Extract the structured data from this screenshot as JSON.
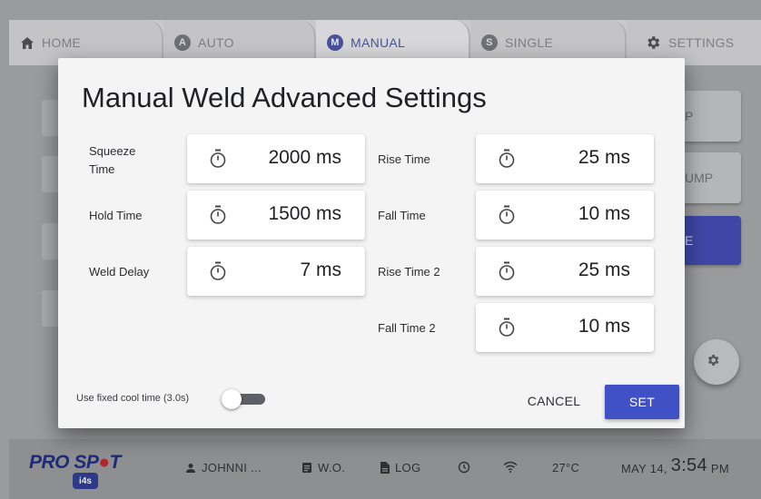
{
  "tabs": [
    {
      "label": "HOME",
      "icon": "home-icon"
    },
    {
      "label": "AUTO",
      "badge": "A"
    },
    {
      "label": "MANUAL",
      "badge": "M",
      "active": true
    },
    {
      "label": "SINGLE",
      "badge": "S"
    },
    {
      "label": "SETTINGS",
      "icon": "gear-icon"
    }
  ],
  "background": {
    "side_buttons": [
      "P",
      "UMP",
      "E"
    ]
  },
  "dialog": {
    "title": "Manual Weld Advanced Settings",
    "fields_left": [
      {
        "label": "Squeeze\nTime",
        "value": "2000 ms",
        "icon": "timer-icon"
      },
      {
        "label": "Hold Time",
        "value": "1500 ms",
        "icon": "timer-icon"
      },
      {
        "label": "Weld Delay",
        "value": "7 ms",
        "icon": "timer-icon"
      }
    ],
    "fields_right": [
      {
        "label": "Rise Time",
        "value": "25 ms",
        "icon": "timer-icon"
      },
      {
        "label": "Fall Time",
        "value": "10 ms",
        "icon": "timer-icon"
      },
      {
        "label": "Rise Time 2",
        "value": "25 ms",
        "icon": "timer-icon"
      },
      {
        "label": "Fall Time 2",
        "value": "10 ms",
        "icon": "timer-icon"
      }
    ],
    "toggle_label": "Use fixed cool time (3.0s)",
    "toggle_on": false,
    "cancel_label": "CANCEL",
    "set_label": "SET",
    "accent_color": "#3f51c4"
  },
  "statusbar": {
    "logo_main": "PRO SP",
    "logo_red": "●",
    "logo_end": "T",
    "logo_sub": "i4s",
    "user": "JOHNNI ...",
    "wo": "W.O.",
    "log": "LOG",
    "temperature": "27°C",
    "date": "MAY 14,",
    "time": "3:54",
    "ampm": "PM"
  }
}
